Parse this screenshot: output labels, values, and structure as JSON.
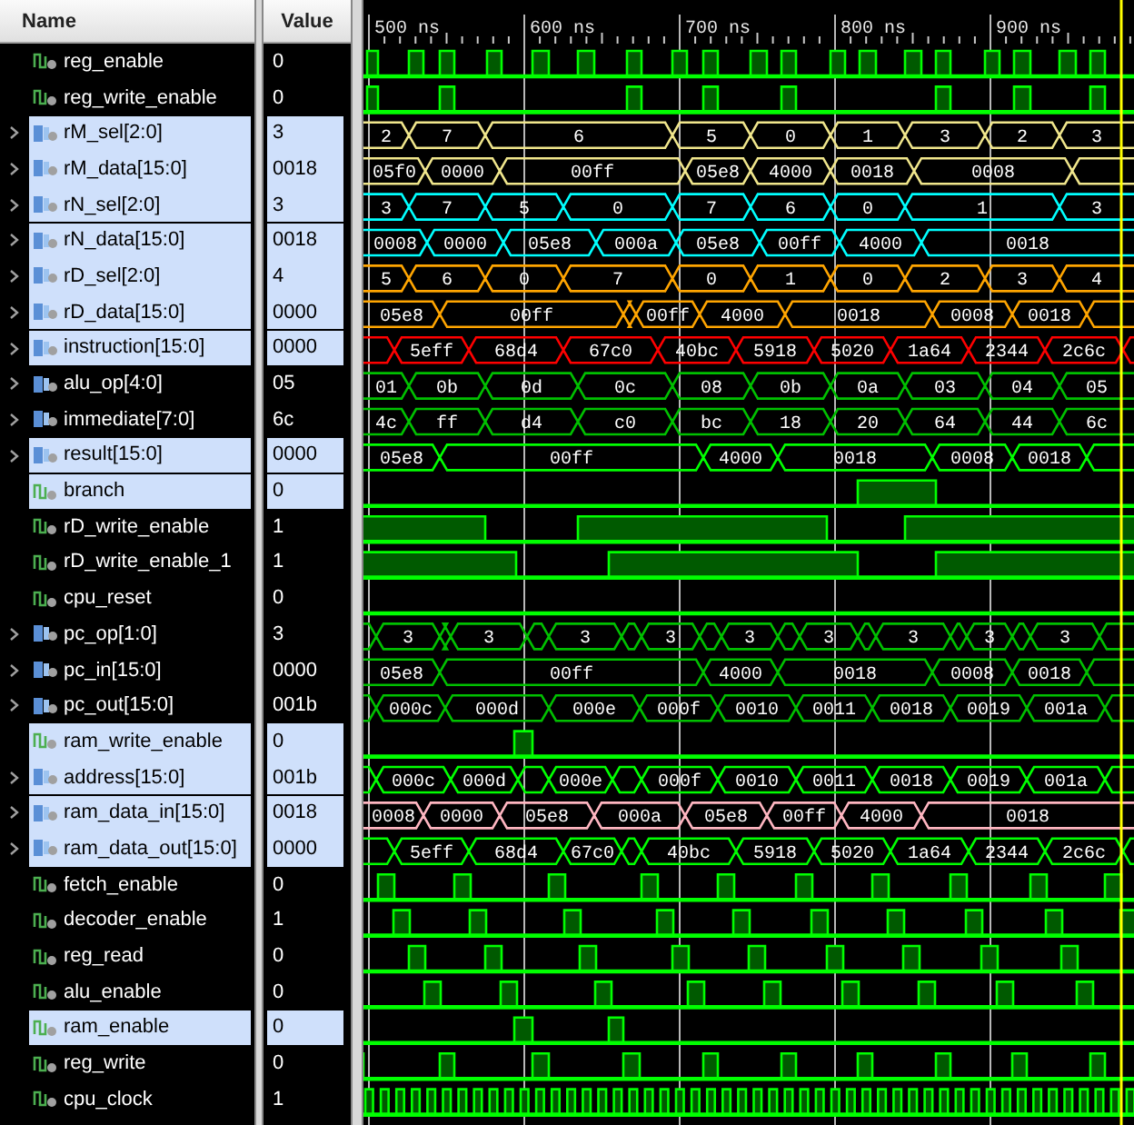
{
  "columns": {
    "name": "Name",
    "value": "Value"
  },
  "timeline": [
    "500 ns",
    "600 ns",
    "700 ns",
    "800 ns",
    "900 ns"
  ],
  "signals": [
    {
      "name": "reg_enable",
      "kind": "bit",
      "value": "0",
      "selected": false,
      "color": "#00ff00"
    },
    {
      "name": "reg_write_enable",
      "kind": "bit",
      "value": "0",
      "selected": false,
      "color": "#00ff00"
    },
    {
      "name": "rM_sel[2:0]",
      "kind": "bus",
      "value": "3",
      "selected": true,
      "color": "#f0e68c",
      "segments": [
        "2",
        "7",
        "6",
        "5",
        "0",
        "1",
        "3",
        "2",
        "3"
      ]
    },
    {
      "name": "rM_data[15:0]",
      "kind": "bus",
      "value": "0018",
      "selected": true,
      "color": "#f0e68c",
      "segments": [
        "05f0",
        "0000",
        "00ff",
        "05e8",
        "4000",
        "0018",
        "0008"
      ]
    },
    {
      "name": "rN_sel[2:0]",
      "kind": "bus",
      "value": "3",
      "selected": true,
      "color": "#00ffff",
      "segments": [
        "3",
        "7",
        "5",
        "0",
        "7",
        "6",
        "0",
        "1",
        "3"
      ]
    },
    {
      "name": "rN_data[15:0]",
      "kind": "bus",
      "value": "0018",
      "selected": true,
      "color": "#00ffff",
      "segments": [
        "0008",
        "0000",
        "05e8",
        "000a",
        "05e8",
        "00ff",
        "4000",
        "0018"
      ]
    },
    {
      "name": "rD_sel[2:0]",
      "kind": "bus",
      "value": "4",
      "selected": true,
      "color": "#ffa500",
      "segments": [
        "5",
        "6",
        "0",
        "7",
        "0",
        "1",
        "0",
        "2",
        "3",
        "4"
      ]
    },
    {
      "name": "rD_data[15:0]",
      "kind": "bus",
      "value": "0000",
      "selected": true,
      "color": "#ffa500",
      "segments": [
        "05e8",
        "00ff",
        "00ff",
        "4000",
        "0018",
        "0008",
        "0018"
      ]
    },
    {
      "name": "instruction[15:0]",
      "kind": "bus",
      "value": "0000",
      "selected": true,
      "color": "#ff0000",
      "segments": [
        "5eff",
        "68d4",
        "67c0",
        "40bc",
        "5918",
        "5020",
        "1a64",
        "2344",
        "2c6c"
      ]
    },
    {
      "name": "alu_op[4:0]",
      "kind": "bus",
      "value": "05",
      "selected": false,
      "color": "#00c000",
      "segments": [
        "01",
        "0b",
        "0d",
        "0c",
        "08",
        "0b",
        "0a",
        "03",
        "04",
        "05"
      ]
    },
    {
      "name": "immediate[7:0]",
      "kind": "bus",
      "value": "6c",
      "selected": false,
      "color": "#00c000",
      "segments": [
        "4c",
        "ff",
        "d4",
        "c0",
        "bc",
        "18",
        "20",
        "64",
        "44",
        "6c"
      ]
    },
    {
      "name": "result[15:0]",
      "kind": "bus",
      "value": "0000",
      "selected": true,
      "color": "#00ff00",
      "segments": [
        "05e8",
        "00ff",
        "4000",
        "0018",
        "0008",
        "0018"
      ]
    },
    {
      "name": "branch",
      "kind": "bit",
      "value": "0",
      "selected": true,
      "color": "#00ff00"
    },
    {
      "name": "rD_write_enable",
      "kind": "bit",
      "value": "1",
      "selected": false,
      "color": "#00ff00"
    },
    {
      "name": "rD_write_enable_1",
      "kind": "bit",
      "value": "1",
      "selected": false,
      "color": "#00ff00"
    },
    {
      "name": "cpu_reset",
      "kind": "bit",
      "value": "0",
      "selected": false,
      "color": "#00ff00"
    },
    {
      "name": "pc_op[1:0]",
      "kind": "bus",
      "value": "3",
      "selected": false,
      "color": "#00c000",
      "segments": [
        "3",
        "3",
        "3",
        "3",
        "3",
        "3",
        "3",
        "3",
        "3"
      ]
    },
    {
      "name": "pc_in[15:0]",
      "kind": "bus",
      "value": "0000",
      "selected": false,
      "color": "#00c000",
      "segments": [
        "05e8",
        "00ff",
        "4000",
        "0018",
        "0008",
        "0018"
      ]
    },
    {
      "name": "pc_out[15:0]",
      "kind": "bus",
      "value": "001b",
      "selected": false,
      "color": "#00c000",
      "segments": [
        "000c",
        "000d",
        "000e",
        "000f",
        "0010",
        "0011",
        "0018",
        "0019",
        "001a"
      ]
    },
    {
      "name": "ram_write_enable",
      "kind": "bit",
      "value": "0",
      "selected": true,
      "color": "#00ff00"
    },
    {
      "name": "address[15:0]",
      "kind": "bus",
      "value": "001b",
      "selected": true,
      "color": "#00ff00",
      "segments": [
        "000c",
        "000d",
        "000e",
        "000f",
        "0010",
        "0011",
        "0018",
        "0019",
        "001a"
      ]
    },
    {
      "name": "ram_data_in[15:0]",
      "kind": "bus",
      "value": "0018",
      "selected": true,
      "color": "#ffb6c1",
      "segments": [
        "0008",
        "0000",
        "05e8",
        "000a",
        "05e8",
        "00ff",
        "4000",
        "0018"
      ]
    },
    {
      "name": "ram_data_out[15:0]",
      "kind": "bus",
      "value": "0000",
      "selected": true,
      "color": "#00ff00",
      "segments": [
        "5eff",
        "68d4",
        "67c0",
        "40bc",
        "5918",
        "5020",
        "1a64",
        "2344",
        "2c6c"
      ]
    },
    {
      "name": "fetch_enable",
      "kind": "bit",
      "value": "0",
      "selected": false,
      "color": "#00ff00"
    },
    {
      "name": "decoder_enable",
      "kind": "bit",
      "value": "1",
      "selected": false,
      "color": "#00ff00"
    },
    {
      "name": "reg_read",
      "kind": "bit",
      "value": "0",
      "selected": false,
      "color": "#00ff00"
    },
    {
      "name": "alu_enable",
      "kind": "bit",
      "value": "0",
      "selected": false,
      "color": "#00ff00"
    },
    {
      "name": "ram_enable",
      "kind": "bit",
      "value": "0",
      "selected": true,
      "color": "#00ff00"
    },
    {
      "name": "reg_write",
      "kind": "bit",
      "value": "0",
      "selected": false,
      "color": "#00ff00"
    },
    {
      "name": "cpu_clock",
      "kind": "bit",
      "value": "1",
      "selected": false,
      "color": "#00ff00"
    }
  ]
}
